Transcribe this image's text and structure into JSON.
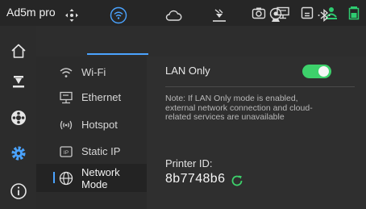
{
  "app": {
    "title": "Ad5m pro"
  },
  "header": {
    "icons": [
      "camera-icon",
      "monitor-icon",
      "storage-icon",
      "person-icon",
      "battery-icon"
    ]
  },
  "sidebar": {
    "items": [
      {
        "icon": "home-icon",
        "active": false
      },
      {
        "icon": "extruder-icon",
        "active": false
      },
      {
        "icon": "filament-spool-icon",
        "active": false
      },
      {
        "icon": "settings-gear-icon",
        "active": true
      },
      {
        "icon": "info-icon",
        "active": false
      }
    ]
  },
  "tabs": [
    {
      "icon": "move-arrows-icon",
      "active": false
    },
    {
      "icon": "wifi-signal-icon",
      "active": true
    },
    {
      "icon": "cloud-icon",
      "active": false
    },
    {
      "icon": "nozzle-heat-icon",
      "active": false
    },
    {
      "icon": "webcam-icon",
      "active": false
    },
    {
      "icon": "bluetooth-icon",
      "active": false
    }
  ],
  "submenu": {
    "items": [
      {
        "label": "Wi-Fi",
        "icon": "wifi-icon"
      },
      {
        "label": "Ethernet",
        "icon": "ethernet-icon"
      },
      {
        "label": "Hotspot",
        "icon": "hotspot-icon"
      },
      {
        "label": "Static IP",
        "icon": "ip-icon"
      },
      {
        "label": "Network Mode",
        "icon": "globe-icon",
        "active": true
      }
    ]
  },
  "network_mode": {
    "lan_only_label": "LAN Only",
    "lan_only_enabled": true,
    "note": "Note: If LAN Only mode is enabled, external network connection and cloud-related services are unavailable",
    "printer_id_label": "Printer ID:",
    "printer_id_value": "8b7748b6"
  },
  "colors": {
    "accent": "#4aa3ff",
    "toggle_on": "#3dd16b",
    "refresh": "#3dd16b",
    "header_person": "#2ecc71"
  }
}
